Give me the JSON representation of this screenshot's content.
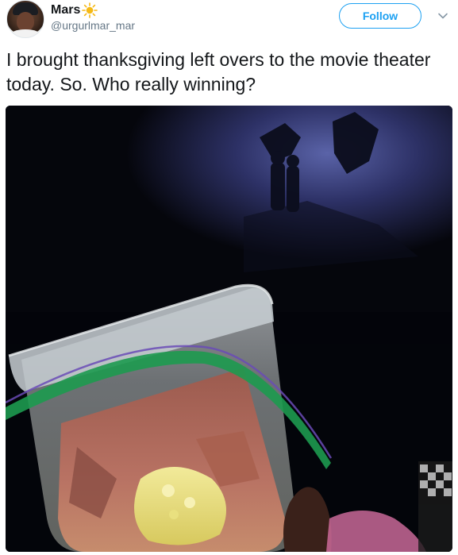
{
  "user": {
    "display_name": "Mars",
    "handle": "@urgurlmar_mar"
  },
  "header": {
    "follow_label": "Follow"
  },
  "tweet": {
    "text": "I brought thanksgiving left overs to the movie theater today. So. Who really winning?"
  },
  "colors": {
    "accent": "#1da1f2",
    "text": "#14171a",
    "secondary_text": "#657786",
    "sun_emoji": "#f5b915"
  },
  "icons": {
    "sun": "sun-icon",
    "menu": "chevron-down-icon"
  }
}
